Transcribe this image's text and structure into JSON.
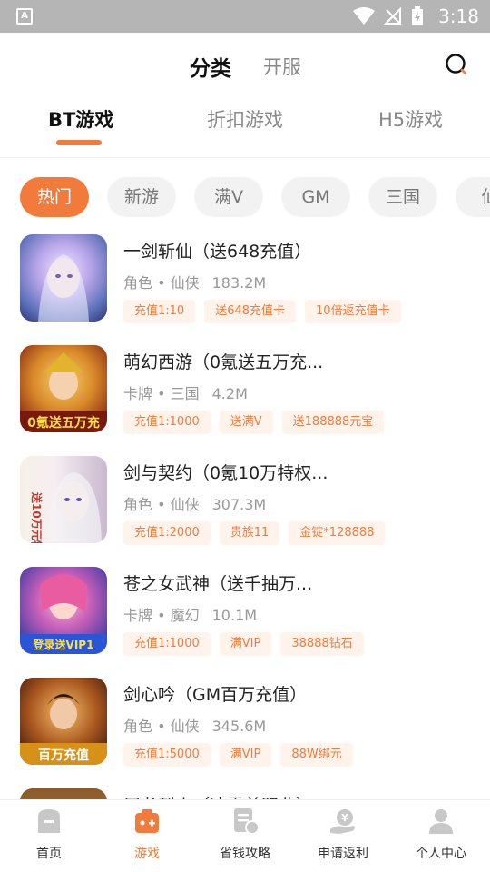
{
  "status_bar": {
    "time": "3:18",
    "app_icon_letter": "A"
  },
  "header": {
    "tab_main": "分类",
    "tab_open": "开服"
  },
  "subtabs": [
    {
      "label": "BT游戏",
      "active": true
    },
    {
      "label": "折扣游戏",
      "active": false
    },
    {
      "label": "H5游戏",
      "active": false
    }
  ],
  "chips": [
    {
      "label": "热门",
      "active": true
    },
    {
      "label": "新游"
    },
    {
      "label": "满V"
    },
    {
      "label": "GM"
    },
    {
      "label": "三国"
    },
    {
      "label": "仙"
    }
  ],
  "games": [
    {
      "title": "一剑斩仙（送648充值）",
      "category": "角色 • 仙侠",
      "size": "183.2M",
      "tags": [
        "充值1:10",
        "送648充值卡",
        "10倍返充值卡"
      ]
    },
    {
      "title": "萌幻西游（0氪送五万充...",
      "category": "卡牌 • 三国",
      "size": "4.2M",
      "tags": [
        "充值1:1000",
        "送满V",
        "送188888元宝"
      ],
      "thumb_text": "0氪送五万充"
    },
    {
      "title": "剑与契约（0氪10万特权...",
      "category": "角色 • 仙侠",
      "size": "307.3M",
      "tags": [
        "充值1:2000",
        "贵族11",
        "金锭*128888"
      ],
      "thumb_text": "送10万元特权"
    },
    {
      "title": "苍之女武神（送千抽万...",
      "category": "卡牌 • 魔幻",
      "size": "10.1M",
      "tags": [
        "充值1:1000",
        "满VIP",
        "38888钻石"
      ],
      "thumb_text": "登录送VIP1"
    },
    {
      "title": "剑心吟（GM百万充值）",
      "category": "角色 • 仙侠",
      "size": "345.6M",
      "tags": [
        "充值1:5000",
        "满VIP",
        "88W绑元"
      ],
      "thumb_text": "百万充值"
    },
    {
      "title": "屠龙烈火（冰雪单职业）",
      "category": "",
      "size": "",
      "tags": []
    }
  ],
  "bottom_nav": [
    {
      "label": "首页",
      "icon": "home-icon"
    },
    {
      "label": "游戏",
      "icon": "game-icon",
      "active": true
    },
    {
      "label": "省钱攻略",
      "icon": "guide-icon"
    },
    {
      "label": "申请返利",
      "icon": "rebate-icon"
    },
    {
      "label": "个人中心",
      "icon": "profile-icon"
    }
  ],
  "colors": {
    "accent": "#f27b3b",
    "tag_bg": "#fff3ec",
    "inactive_icon": "#c8c8c8"
  }
}
